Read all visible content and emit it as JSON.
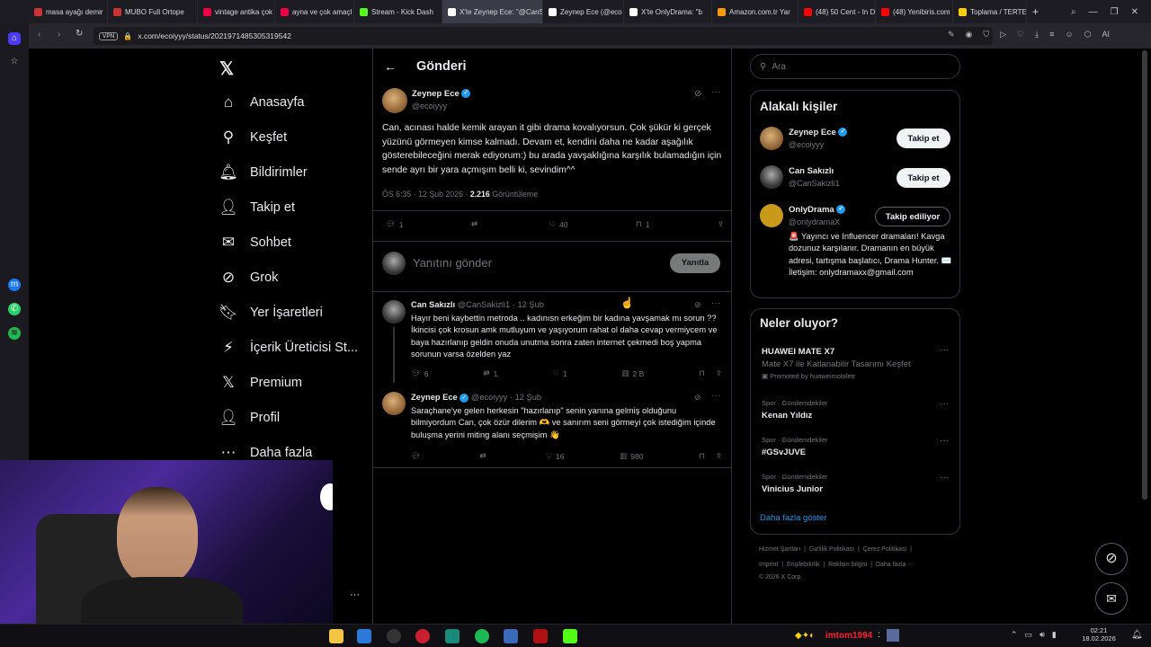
{
  "browser": {
    "tabs": [
      {
        "label": "masa ayağı demir",
        "color": "#c33"
      },
      {
        "label": "MUBO Full Ortope",
        "color": "#c33"
      },
      {
        "label": "vintage antika çok",
        "color": "#e04"
      },
      {
        "label": "ayna ve çok amaçl",
        "color": "#e04"
      },
      {
        "label": "Stream - Kick Dash",
        "color": "#53fc18"
      },
      {
        "label": "X'te Zeynep Ece: \"@CanS",
        "color": "#fff"
      },
      {
        "label": "Zeynep Ece (@eco",
        "color": "#fff"
      },
      {
        "label": "X'te OnlyDrama: \"b",
        "color": "#fff"
      },
      {
        "label": "Amazon.com.tr Yar",
        "color": "#ff9900"
      },
      {
        "label": "(48) 50 Cent - In D",
        "color": "#f00"
      },
      {
        "label": "(48) Yenibiris.com",
        "color": "#f00"
      },
      {
        "label": "Toplama / TERTEM",
        "color": "#fc0"
      }
    ],
    "url": "x.com/ecoiyyy/status/2021971485305319542",
    "vpn": "VPN"
  },
  "nav": {
    "home": "Anasayfa",
    "explore": "Keşfet",
    "notifications": "Bildirimler",
    "follow": "Takip et",
    "chat": "Sohbet",
    "grok": "Grok",
    "bookmarks": "Yer İşaretleri",
    "creator": "İçerik Üreticisi St...",
    "premium": "Premium",
    "profile": "Profil",
    "more": "Daha fazla"
  },
  "header": {
    "title": "Gönderi"
  },
  "main_post": {
    "name": "Zeynep Ece",
    "handle": "@ecoiyyy",
    "text": "Can, acınası halde kemik arayan it gibi drama kovalıyorsun. Çok şükür ki gerçek yüzünü görmeyen kimse kalmadı. Devam et, kendini daha ne kadar aşağılık gösterebileceğini merak ediyorum:) bu arada yavşaklığına karşılık bulamadığın için sende ayrı bir yara açmışım belli ki, sevindim^^",
    "time": "ÖS 6:35 · 12 Şub 2026 · ",
    "views": "2.216",
    "views_label": " Görüntüleme",
    "replies": "1",
    "reposts": "",
    "likes": "40",
    "bookmarks": "1"
  },
  "reply_box": {
    "placeholder": "Yanıtını gönder",
    "button": "Yanıtla"
  },
  "replies": [
    {
      "name": "Can Sakızlı",
      "handle": "@CanSakizli1 · 12 Şub",
      "text": "Hayır beni kaybettin metroda .. kadınısn erkeğim bir kadına yavşamak mı sorun ?? İkincisi çok krosun amk mutluyum ve yaşıyorum rahat ol daha cevap vermiycem ve baya hazırlanıp geldin onuda unutma sonra zaten internet çekmedi boş yapma sorunun varsa özelden yaz",
      "replies": "6",
      "reposts": "1",
      "likes": "1",
      "views": "2 B"
    },
    {
      "name": "Zeynep Ece",
      "handle": "@ecoiyyy · 12 Şub",
      "text": "Saraçhane'ye gelen herkesin \"hazırlanıp\" senin yanına gelmiş olduğunu bilmiyordum Can, çok özür dilerim 🫶 ve sanırım seni görmeyi çok istediğim içinde buluşma yerini miting alanı seçmişim 👋",
      "replies": "",
      "reposts": "",
      "likes": "16",
      "views": "980"
    }
  ],
  "search": {
    "placeholder": "Ara"
  },
  "related": {
    "title": "Alakalı kişiler",
    "people": [
      {
        "name": "Zeynep Ece",
        "handle": "@ecoiyyy",
        "button": "Takip et"
      },
      {
        "name": "Can Sakızlı",
        "handle": "@CanSakizli1",
        "button": "Takip et"
      },
      {
        "name": "OnlyDrama",
        "handle": "@onlydramaX",
        "button": "Takip ediliyor",
        "bio": "🚨 Yayıncı ve Influencer dramaları! Kavga dozunuz karşılanır. Dramanın en büyük adresi, tartışma başlatıcı, Drama Hunter. ✉️ İletişim: onlydramaxx@gmail.com"
      }
    ]
  },
  "trends": {
    "title": "Neler oluyor?",
    "items": [
      {
        "name": "HUAWEI MATE X7",
        "sub": "Mate X7 ile Katlanabilir Tasarımı Keşfet",
        "promo": "Promoted by huaweimobiletr"
      },
      {
        "category": "Spor · Gündemdekiler",
        "name": "Kenan Yıldız"
      },
      {
        "category": "Spor · Gündemdekiler",
        "name": "#GSvJUVE"
      },
      {
        "category": "Spor · Gündemdekiler",
        "name": "Vinicius Junior"
      }
    ],
    "more": "Daha fazla göster"
  },
  "footer": {
    "links1": "Hizmet Şartları  |  Gizlilik Politikası  |  Çerez Politikası  |",
    "links2": "Imprint  |  Erişilebilirlik  |  Reklam bilgisi  |  Daha fazla ···",
    "copyright": "© 2026 X Corp."
  },
  "taskbar": {
    "username": "imtom1994",
    "time": "02:21",
    "date": "18.02.2026"
  }
}
